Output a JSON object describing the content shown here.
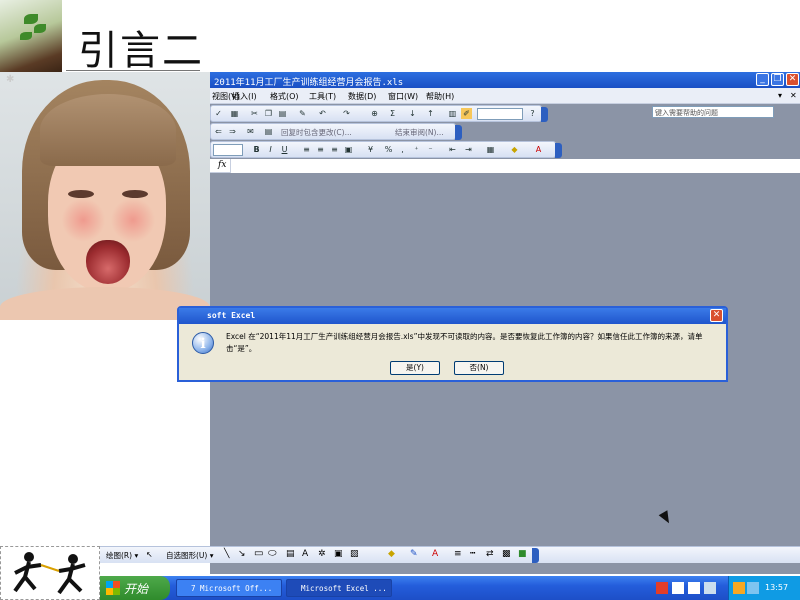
{
  "slide": {
    "title": "引言二"
  },
  "excel": {
    "window_title": "2011年11月工厂生产训练组经营月会报告.xls",
    "menu": [
      "视图(V)",
      "插入(I)",
      "格式(O)",
      "工具(T)",
      "数据(D)",
      "窗口(W)",
      "帮助(H)"
    ],
    "help_placeholder": "键入需要帮助的问题",
    "reviewing_text": "回复时包含更改(C)...",
    "end_review_text": "结束审阅(N)...",
    "fx_label": "fx"
  },
  "dialog": {
    "title": "Microsoft Excel",
    "title_visible": "soft Excel",
    "message": "Excel 在“2011年11月工厂生产训练组经营月会报告.xls”中发现不可读取的内容。是否要恢复此工作簿的内容？如果信任此工作簿的来源，请单击“是”。",
    "yes": "是(Y)",
    "no": "否(N)"
  },
  "drawing_toolbar": {
    "draw": "绘图(R) ▾",
    "autoshapes": "自选图形(U) ▾"
  },
  "taskbar": {
    "start": "开始",
    "tasks": [
      "7 Microsoft Off...",
      "Microsoft Excel ..."
    ],
    "clock": "13:57"
  },
  "colors": {
    "xp_blue": "#245ddb",
    "start_green": "#2f8b2c",
    "close_red": "#d9502f"
  }
}
